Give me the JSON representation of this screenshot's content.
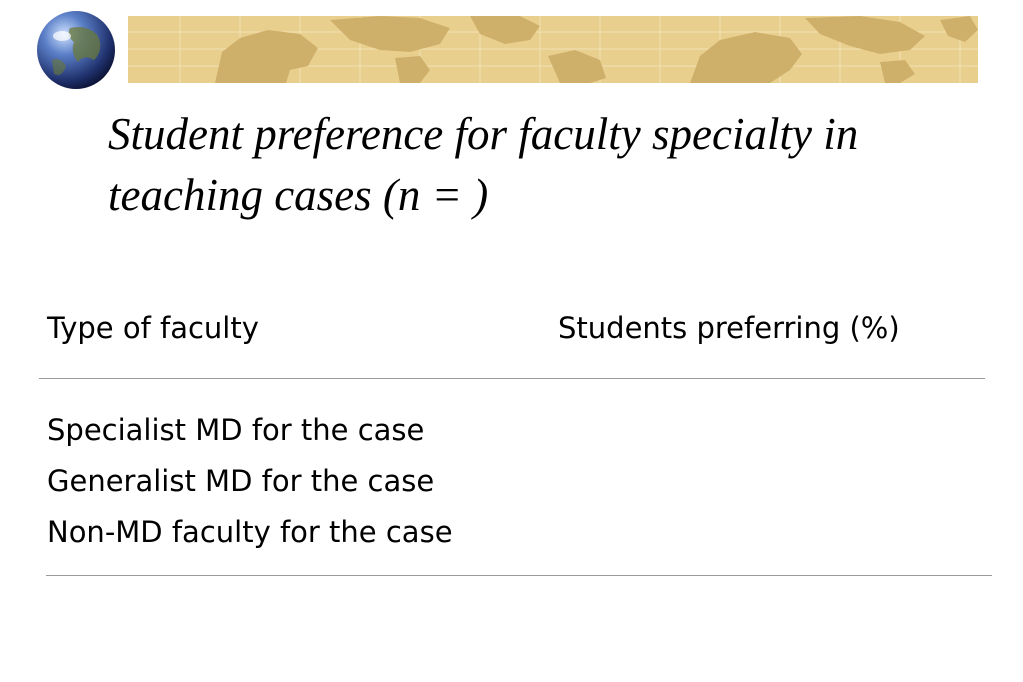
{
  "slide": {
    "title": "Student preference for faculty specialty in teaching cases (n = )"
  },
  "table": {
    "headers": [
      "Type of faculty",
      "Students preferring (%)"
    ],
    "rows": [
      "Specialist MD for the case",
      "Generalist MD for the case",
      "Non-MD faculty for the case"
    ]
  },
  "icons": {
    "globe": "globe-icon",
    "map": "world-map-banner"
  },
  "colors": {
    "banner": "#e9cf8e",
    "land": "#cfb06a"
  }
}
